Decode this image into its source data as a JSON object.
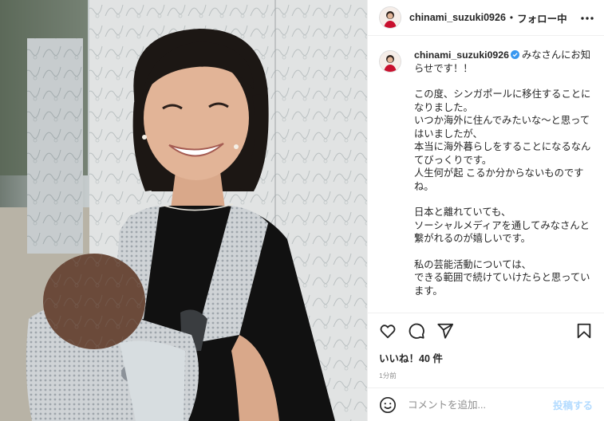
{
  "header": {
    "username": "chinami_suzuki0926",
    "separator": "•",
    "follow_label": "フォロー中",
    "more_icon": "more-horizontal-icon"
  },
  "caption": {
    "username": "chinami_suzuki0926",
    "verified_icon": "verified-badge-icon",
    "verified_color": "#3897f0",
    "lines": [
      "みなさんにお知らせです！！",
      "",
      "この度、シンガポールに移住することになりました。",
      "いつか海外に住んでみたいな〜と思ってはいましたが、",
      "本当に海外暮らしをすることになるなんてびっくりです。",
      "人生何が起 こるか分からないものですね。",
      "",
      "日本と離れていても、",
      "ソーシャルメディアを通してみなさんと繋がれるのが嬉しいです。",
      "",
      "私の芸能活動については、",
      "できる範囲で続けていけたらと思っています。"
    ]
  },
  "actions": {
    "like_icon": "heart-icon",
    "comment_icon": "comment-icon",
    "share_icon": "send-icon",
    "save_icon": "bookmark-icon",
    "likes_text": "いいね！40 件",
    "timestamp": "1分前"
  },
  "comment": {
    "emoji_icon": "emoji-icon",
    "placeholder": "コメントを追加...",
    "post_label": "投稿する",
    "post_color": "#b3dbff"
  },
  "photo": {
    "description_icon": "post-photo"
  }
}
